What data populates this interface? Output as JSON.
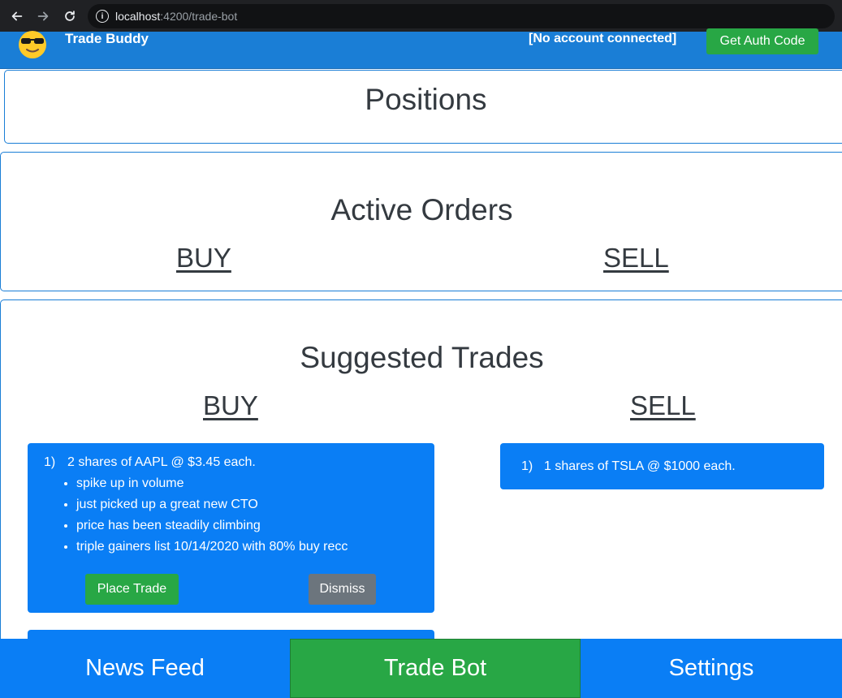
{
  "browser": {
    "url_host": "localhost",
    "url_rest": ":4200/trade-bot"
  },
  "navbar": {
    "logo_icon": "sunglasses-emoji-icon",
    "brand": "Trade Buddy",
    "account_status": "[No account connected]",
    "auth_button": "Get Auth Code"
  },
  "positions": {
    "title": "Positions"
  },
  "active_orders": {
    "title": "Active Orders",
    "buy_label": "BUY",
    "sell_label": "SELL"
  },
  "suggested_trades": {
    "title": "Suggested Trades",
    "buy_label": "BUY",
    "sell_label": "SELL",
    "buy_trades": [
      {
        "index": "1)",
        "summary": "2 shares of AAPL @ $3.45 each.",
        "reasons": [
          "spike up in volume",
          "just picked up a great new CTO",
          "price has been steadily climbing",
          "triple gainers list 10/14/2020 with 80% buy recc"
        ],
        "place_label": "Place Trade",
        "dismiss_label": "Dismiss"
      }
    ],
    "sell_trades": [
      {
        "index": "1)",
        "summary": "1 shares of TSLA @ $1000 each."
      }
    ]
  },
  "tabs": [
    {
      "label": "News Feed",
      "active": false
    },
    {
      "label": "Trade Bot",
      "active": true
    },
    {
      "label": "Settings",
      "active": false
    }
  ],
  "colors": {
    "navbar_blue": "#1a7ed6",
    "trade_blue": "#0a7ef5",
    "success_green": "#28a745",
    "secondary_gray": "#6c757d"
  }
}
